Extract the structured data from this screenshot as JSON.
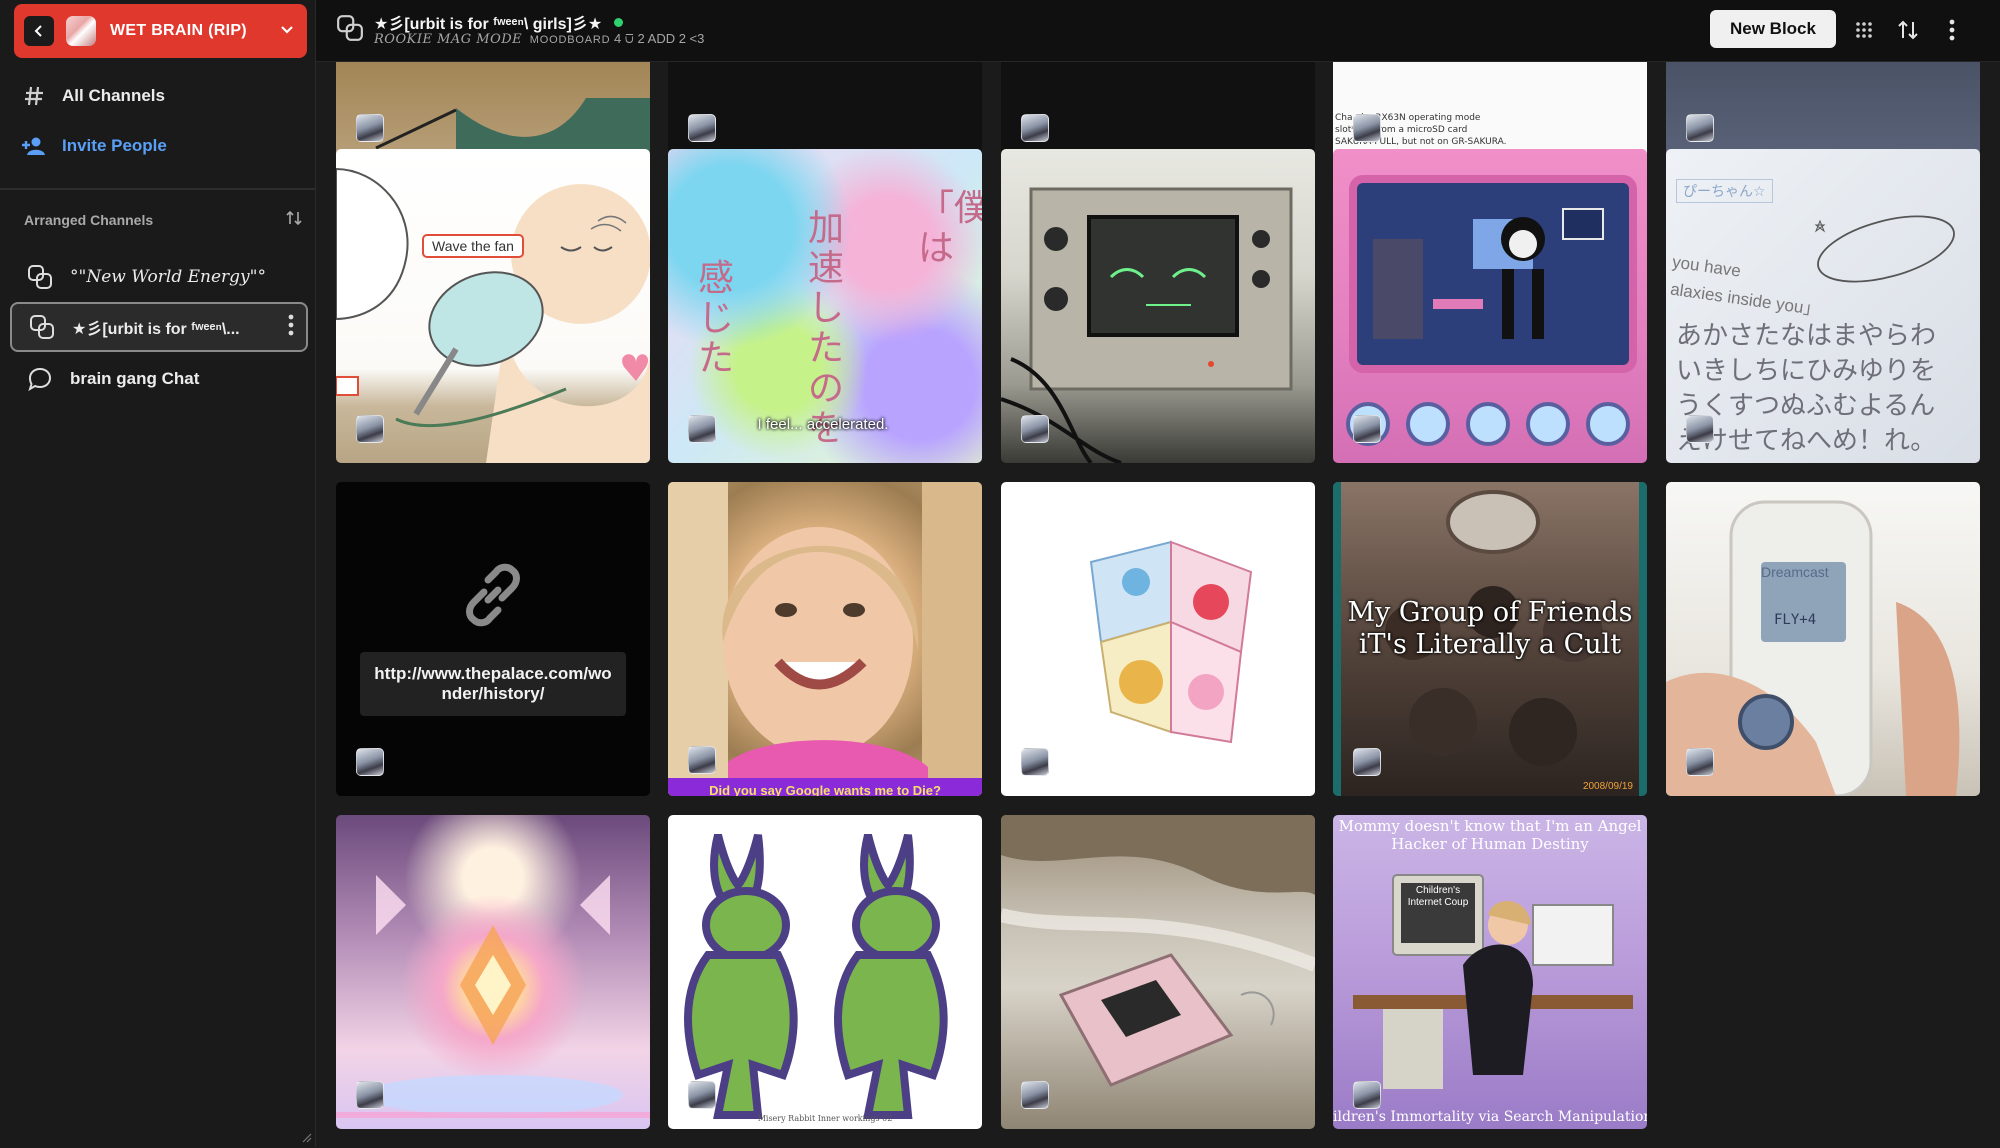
{
  "team": {
    "name": "WET BRAIN (RIP)"
  },
  "nav": {
    "all_channels": "All Channels",
    "invite_people": "Invite People"
  },
  "arranged": {
    "header": "Arranged Channels",
    "channels": [
      {
        "label": "°\"New World Energy\"°"
      },
      {
        "label": "★彡[urbit is for ᶠʷᵉᵉⁿ\\... "
      },
      {
        "label": "brain gang Chat"
      }
    ]
  },
  "topbar": {
    "title": "★彡[urbit is for ᶠʷᵉᵉⁿ\\ girls]彡★",
    "sub_italic": "ROOKIE MAG MODE",
    "sub_smallcaps": "MOODBOARD",
    "sub_counts": "4 ⩂ 2 ADD 2 <3",
    "new_block": "New Block"
  },
  "tiles": {
    "fan": {
      "label": "Wave the fan"
    },
    "accel": {
      "caption": "I feel... accelerated."
    },
    "link": {
      "url": "http://www.thepalace.com/wonder/history/"
    },
    "girl": {
      "caption": "Did you say Google wants me to Die?"
    },
    "cult": {
      "text": "My Group of Friends iT's Literally a Cult",
      "date": "2008/09/19"
    },
    "dreamcast": {
      "brand": "Dreamcast",
      "screen": "FLY+4"
    },
    "angel": {
      "top": "Mommy doesn't know that I'm an Angel Hacker of Human Destiny",
      "monitor": "Children's Internet Coup",
      "bottom": "ildren's Immortality via Search Manipulation"
    },
    "rabbits": {
      "caption": "Misery Rabbit  Inner workings 02"
    },
    "renesas": {
      "line1": "Cha...he RX63N operating mode",
      "line2": "slot* ...s from a microSD card",
      "line3": "SAKURA-FULL, but not on GR-SAKURA."
    },
    "keypad": {
      "line1": "you have",
      "line2": "alaxies inside you」",
      "tag": "ぴーちゃん☆"
    }
  },
  "colors": {
    "accent_team": "#e0382c",
    "invite": "#5a9ff6",
    "online": "#2fd16f"
  }
}
